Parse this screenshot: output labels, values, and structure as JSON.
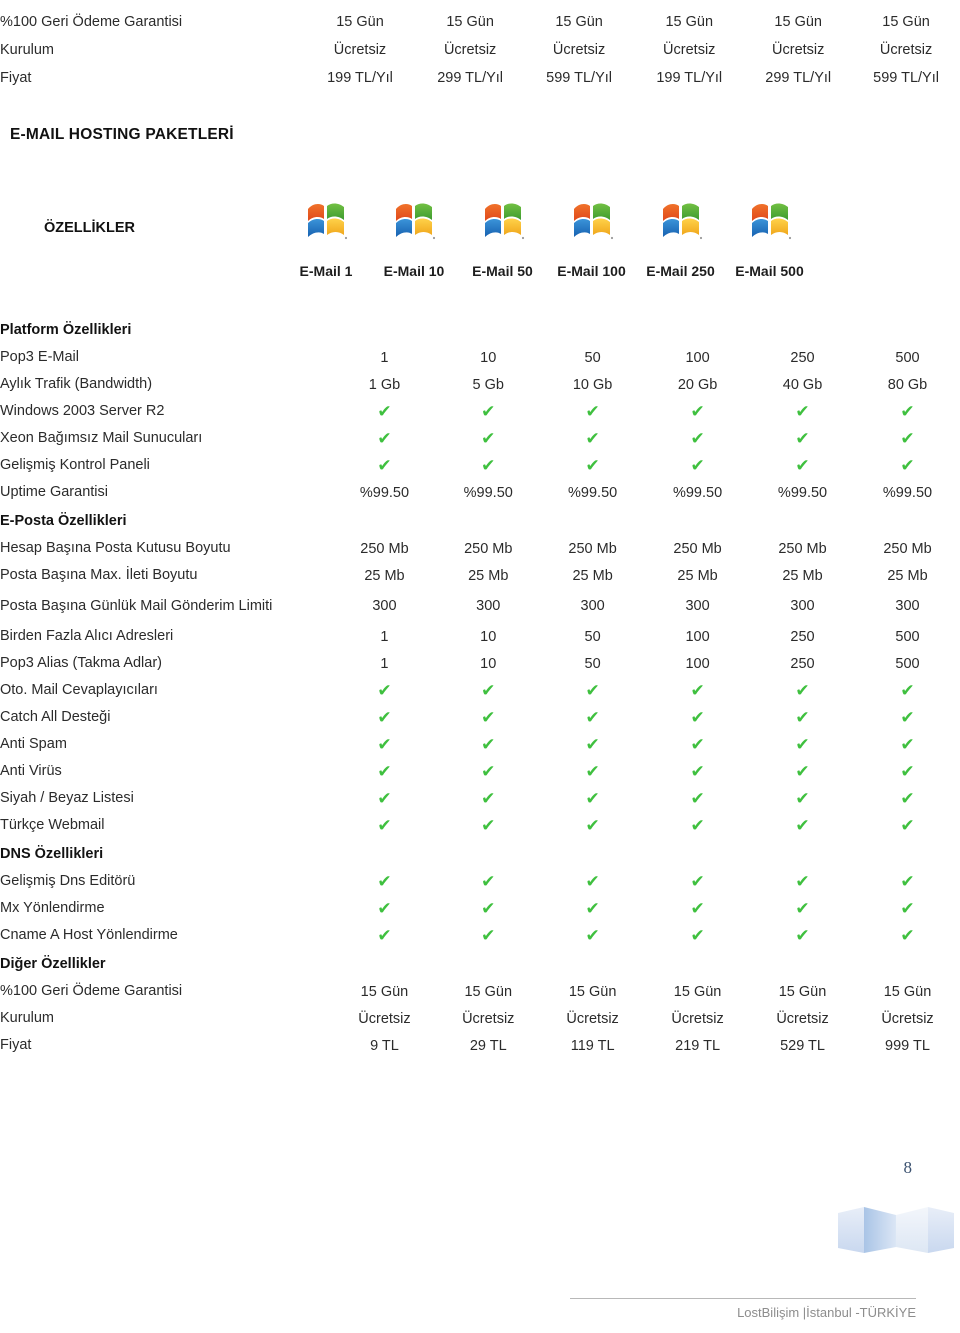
{
  "document": {
    "heading": "E-MAIL HOSTING PAKETLERİ",
    "features_label": "ÖZELLİKLER",
    "page_number": "8",
    "footer_text": "LostBilişim |İstanbul -TÜRKİYE",
    "logo_icon": "windows-logo-icon",
    "ribbon_icon": "ribbon-decoration-icon",
    "check_icon": "check-mark-icon",
    "check_color": "#3fc03f",
    "page_number_color": "#3c5270"
  },
  "top_table": {
    "rows": [
      {
        "label": "%100 Geri Ödeme Garantisi",
        "values": [
          "15 Gün",
          "15 Gün",
          "15 Gün",
          "15 Gün",
          "15 Gün",
          "15 Gün"
        ]
      },
      {
        "label": "Kurulum",
        "values": [
          "Ücretsiz",
          "Ücretsiz",
          "Ücretsiz",
          "Ücretsiz",
          "Ücretsiz",
          "Ücretsiz"
        ]
      },
      {
        "label": "Fiyat",
        "values": [
          "199 TL/Yıl",
          "299 TL/Yıl",
          "599 TL/Yıl",
          "199 TL/Yıl",
          "299 TL/Yıl",
          "599 TL/Yıl"
        ]
      }
    ]
  },
  "packages": [
    {
      "name": "E-Mail 1"
    },
    {
      "name": "E-Mail 10"
    },
    {
      "name": "E-Mail 50"
    },
    {
      "name": "E-Mail 100"
    },
    {
      "name": "E-Mail 250"
    },
    {
      "name": "E-Mail 500"
    }
  ],
  "sections": [
    {
      "title": "Platform Özellikleri",
      "rows": [
        {
          "label": "Pop3 E-Mail",
          "values": [
            "1",
            "10",
            "50",
            "100",
            "250",
            "500"
          ]
        },
        {
          "label": "Aylık Trafik (Bandwidth)",
          "values": [
            "1 Gb",
            "5 Gb",
            "10 Gb",
            "20 Gb",
            "40 Gb",
            "80 Gb"
          ]
        },
        {
          "label": "Windows 2003 Server R2",
          "values": [
            "✔",
            "✔",
            "✔",
            "✔",
            "✔",
            "✔"
          ],
          "check": true
        },
        {
          "label": "Xeon Bağımsız Mail Sunucuları",
          "values": [
            "✔",
            "✔",
            "✔",
            "✔",
            "✔",
            "✔"
          ],
          "check": true
        },
        {
          "label": "Gelişmiş Kontrol Paneli",
          "values": [
            "✔",
            "✔",
            "✔",
            "✔",
            "✔",
            "✔"
          ],
          "check": true
        },
        {
          "label": "Uptime Garantisi",
          "values": [
            "%99.50",
            "%99.50",
            "%99.50",
            "%99.50",
            "%99.50",
            "%99.50"
          ]
        }
      ]
    },
    {
      "title": "E-Posta Özellikleri",
      "rows": [
        {
          "label": "Hesap Başına Posta Kutusu Boyutu",
          "values": [
            "250 Mb",
            "250 Mb",
            "250 Mb",
            "250 Mb",
            "250 Mb",
            "250 Mb"
          ]
        },
        {
          "label": "Posta Başına Max. İleti Boyutu",
          "values": [
            "25 Mb",
            "25 Mb",
            "25 Mb",
            "25 Mb",
            "25 Mb",
            "25 Mb"
          ]
        },
        {
          "label": "Posta Başına Günlük Mail Gönderim Limiti",
          "values": [
            "300",
            "300",
            "300",
            "300",
            "300",
            "300"
          ],
          "tall": true
        },
        {
          "label": "Birden Fazla Alıcı Adresleri",
          "values": [
            "1",
            "10",
            "50",
            "100",
            "250",
            "500"
          ]
        },
        {
          "label": "Pop3 Alias (Takma Adlar)",
          "values": [
            "1",
            "10",
            "50",
            "100",
            "250",
            "500"
          ]
        },
        {
          "label": "Oto. Mail Cevaplayıcıları",
          "values": [
            "✔",
            "✔",
            "✔",
            "✔",
            "✔",
            "✔"
          ],
          "check": true
        },
        {
          "label": "Catch All Desteği",
          "values": [
            "✔",
            "✔",
            "✔",
            "✔",
            "✔",
            "✔"
          ],
          "check": true
        },
        {
          "label": "Anti Spam",
          "values": [
            "✔",
            "✔",
            "✔",
            "✔",
            "✔",
            "✔"
          ],
          "check": true
        },
        {
          "label": "Anti Virüs",
          "values": [
            "✔",
            "✔",
            "✔",
            "✔",
            "✔",
            "✔"
          ],
          "check": true
        },
        {
          "label": "Siyah / Beyaz Listesi",
          "values": [
            "✔",
            "✔",
            "✔",
            "✔",
            "✔",
            "✔"
          ],
          "check": true
        },
        {
          "label": "Türkçe Webmail",
          "values": [
            "✔",
            "✔",
            "✔",
            "✔",
            "✔",
            "✔"
          ],
          "check": true
        }
      ]
    },
    {
      "title": "DNS Özellikleri",
      "rows": [
        {
          "label": "Gelişmiş Dns Editörü",
          "values": [
            "✔",
            "✔",
            "✔",
            "✔",
            "✔",
            "✔"
          ],
          "check": true
        },
        {
          "label": "Mx Yönlendirme",
          "values": [
            "✔",
            "✔",
            "✔",
            "✔",
            "✔",
            "✔"
          ],
          "check": true
        },
        {
          "label": "Cname A Host Yönlendirme",
          "values": [
            "✔",
            "✔",
            "✔",
            "✔",
            "✔",
            "✔"
          ],
          "check": true
        }
      ]
    },
    {
      "title": "Diğer Özellikler",
      "rows": [
        {
          "label": "%100 Geri Ödeme Garantisi",
          "values": [
            "15 Gün",
            "15 Gün",
            "15 Gün",
            "15 Gün",
            "15 Gün",
            "15 Gün"
          ]
        },
        {
          "label": "Kurulum",
          "values": [
            "Ücretsiz",
            "Ücretsiz",
            "Ücretsiz",
            "Ücretsiz",
            "Ücretsiz",
            "Ücretsiz"
          ]
        },
        {
          "label": "Fiyat",
          "values": [
            "9 TL",
            "29 TL",
            "119 TL",
            "219 TL",
            "529 TL",
            "999 TL"
          ]
        }
      ]
    }
  ]
}
